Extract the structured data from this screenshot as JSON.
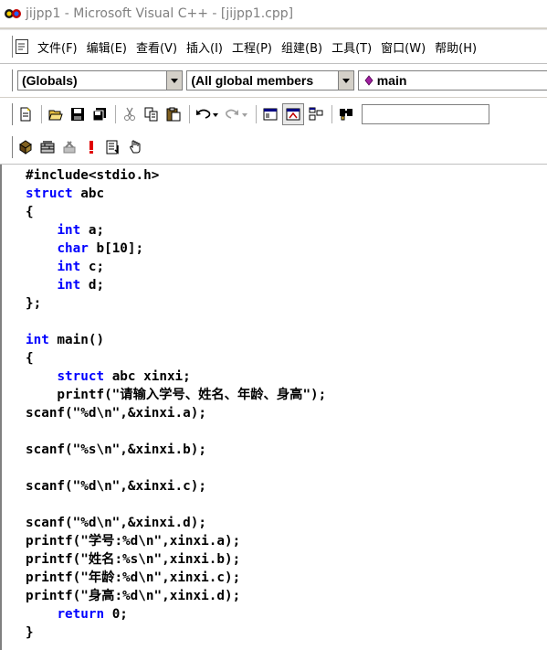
{
  "window": {
    "title": "jijpp1 - Microsoft Visual C++ - [jijpp1.cpp]"
  },
  "menu": {
    "items": [
      "文件(F)",
      "编辑(E)",
      "查看(V)",
      "插入(I)",
      "工程(P)",
      "组建(B)",
      "工具(T)",
      "窗口(W)",
      "帮助(H)"
    ]
  },
  "wizard": {
    "scope": "(Globals)",
    "filter": "(All global members",
    "member": "main"
  },
  "toolbar1": {
    "icons": [
      "new-file-icon",
      "open-folder-icon",
      "save-icon",
      "save-all-icon",
      "cut-icon",
      "copy-icon",
      "paste-icon",
      "undo-icon",
      "redo-icon",
      "workspace-icon",
      "output-icon",
      "window-list-icon",
      "find-in-files-icon"
    ],
    "find_value": ""
  },
  "toolbar2": {
    "icons": [
      "compile-icon",
      "build-icon",
      "stop-build-icon",
      "execute-icon",
      "go-icon",
      "breakpoint-icon"
    ]
  },
  "editor": {
    "lines": [
      [
        {
          "t": "#include<stdio.h>",
          "k": false
        }
      ],
      [
        {
          "t": "struct",
          "k": true
        },
        {
          "t": " abc",
          "k": false
        }
      ],
      [
        {
          "t": "{",
          "k": false
        }
      ],
      [
        {
          "t": "    ",
          "k": false
        },
        {
          "t": "int",
          "k": true
        },
        {
          "t": " a;",
          "k": false
        }
      ],
      [
        {
          "t": "    ",
          "k": false
        },
        {
          "t": "char",
          "k": true
        },
        {
          "t": " b[10];",
          "k": false
        }
      ],
      [
        {
          "t": "    ",
          "k": false
        },
        {
          "t": "int",
          "k": true
        },
        {
          "t": " c;",
          "k": false
        }
      ],
      [
        {
          "t": "    ",
          "k": false
        },
        {
          "t": "int",
          "k": true
        },
        {
          "t": " d;",
          "k": false
        }
      ],
      [
        {
          "t": "};",
          "k": false
        }
      ],
      [
        {
          "t": "",
          "k": false
        }
      ],
      [
        {
          "t": "int",
          "k": true
        },
        {
          "t": " main()",
          "k": false
        }
      ],
      [
        {
          "t": "{",
          "k": false
        }
      ],
      [
        {
          "t": "    ",
          "k": false
        },
        {
          "t": "struct",
          "k": true
        },
        {
          "t": " abc xinxi;",
          "k": false
        }
      ],
      [
        {
          "t": "    printf(\"请输入学号、姓名、年龄、身高\");",
          "k": false
        }
      ],
      [
        {
          "t": "scanf(\"%d\\n\",&xinxi.a);",
          "k": false
        }
      ],
      [
        {
          "t": "",
          "k": false
        }
      ],
      [
        {
          "t": "scanf(\"%s\\n\",&xinxi.b);",
          "k": false
        }
      ],
      [
        {
          "t": "",
          "k": false
        }
      ],
      [
        {
          "t": "scanf(\"%d\\n\",&xinxi.c);",
          "k": false
        }
      ],
      [
        {
          "t": "",
          "k": false
        }
      ],
      [
        {
          "t": "scanf(\"%d\\n\",&xinxi.d);",
          "k": false
        }
      ],
      [
        {
          "t": "printf(\"学号:%d\\n\",xinxi.a);",
          "k": false
        }
      ],
      [
        {
          "t": "printf(\"姓名:%s\\n\",xinxi.b);",
          "k": false
        }
      ],
      [
        {
          "t": "printf(\"年龄:%d\\n\",xinxi.c);",
          "k": false
        }
      ],
      [
        {
          "t": "printf(\"身高:%d\\n\",xinxi.d);",
          "k": false
        }
      ],
      [
        {
          "t": "    ",
          "k": false
        },
        {
          "t": "return",
          "k": true
        },
        {
          "t": " 0;",
          "k": false
        }
      ],
      [
        {
          "t": "}",
          "k": false
        }
      ]
    ]
  },
  "colors": {
    "keyword": "#0000ff",
    "text": "#000000",
    "title_text": "#808080",
    "member_marker": "#a020a0"
  }
}
